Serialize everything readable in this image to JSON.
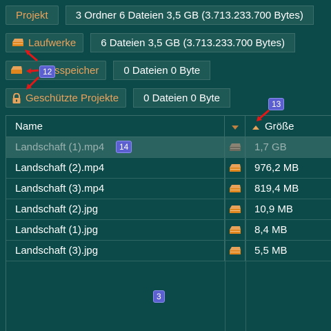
{
  "top": {
    "project_button": "Projekt",
    "project_info": "3 Ordner  6 Dateien  3,5 GB (3.713.233.700 Bytes)"
  },
  "drives": {
    "button": "Laufwerke",
    "info": "6 Dateien  3,5 GB (3.713.233.700 Bytes)"
  },
  "workspace": {
    "button": "Arbeitsspeicher",
    "button_visible": "tsspeicher",
    "info": "0 Dateien  0 Byte"
  },
  "protected": {
    "button": "Geschützte Projekte",
    "info": "0 Dateien  0 Byte"
  },
  "table": {
    "headers": {
      "name": "Name",
      "size": "Größe"
    },
    "rows": [
      {
        "name": "Landschaft (1).mp4",
        "size": "1,7 GB",
        "selected": true
      },
      {
        "name": "Landschaft (2).mp4",
        "size": "976,2 MB",
        "selected": false
      },
      {
        "name": "Landschaft (3).mp4",
        "size": "819,4 MB",
        "selected": false
      },
      {
        "name": "Landschaft (2).jpg",
        "size": "10,9 MB",
        "selected": false
      },
      {
        "name": "Landschaft (1).jpg",
        "size": "8,4 MB",
        "selected": false
      },
      {
        "name": "Landschaft (3).jpg",
        "size": "5,5 MB",
        "selected": false
      }
    ]
  },
  "annotations": {
    "badge_12": "12",
    "badge_13": "13",
    "badge_14": "14",
    "badge_3": "3"
  },
  "colors": {
    "background": "#0b4a48",
    "accent": "#e9a25a",
    "panel": "#1f5956",
    "border": "#3b6e6a",
    "badge": "#5b5fd0",
    "marker": "#e01818"
  },
  "icons": {
    "drive": "drive-icon",
    "lock": "lock-icon",
    "sort_down": "sort-chevron-down-icon",
    "sort_up": "sort-arrow-up-icon"
  }
}
